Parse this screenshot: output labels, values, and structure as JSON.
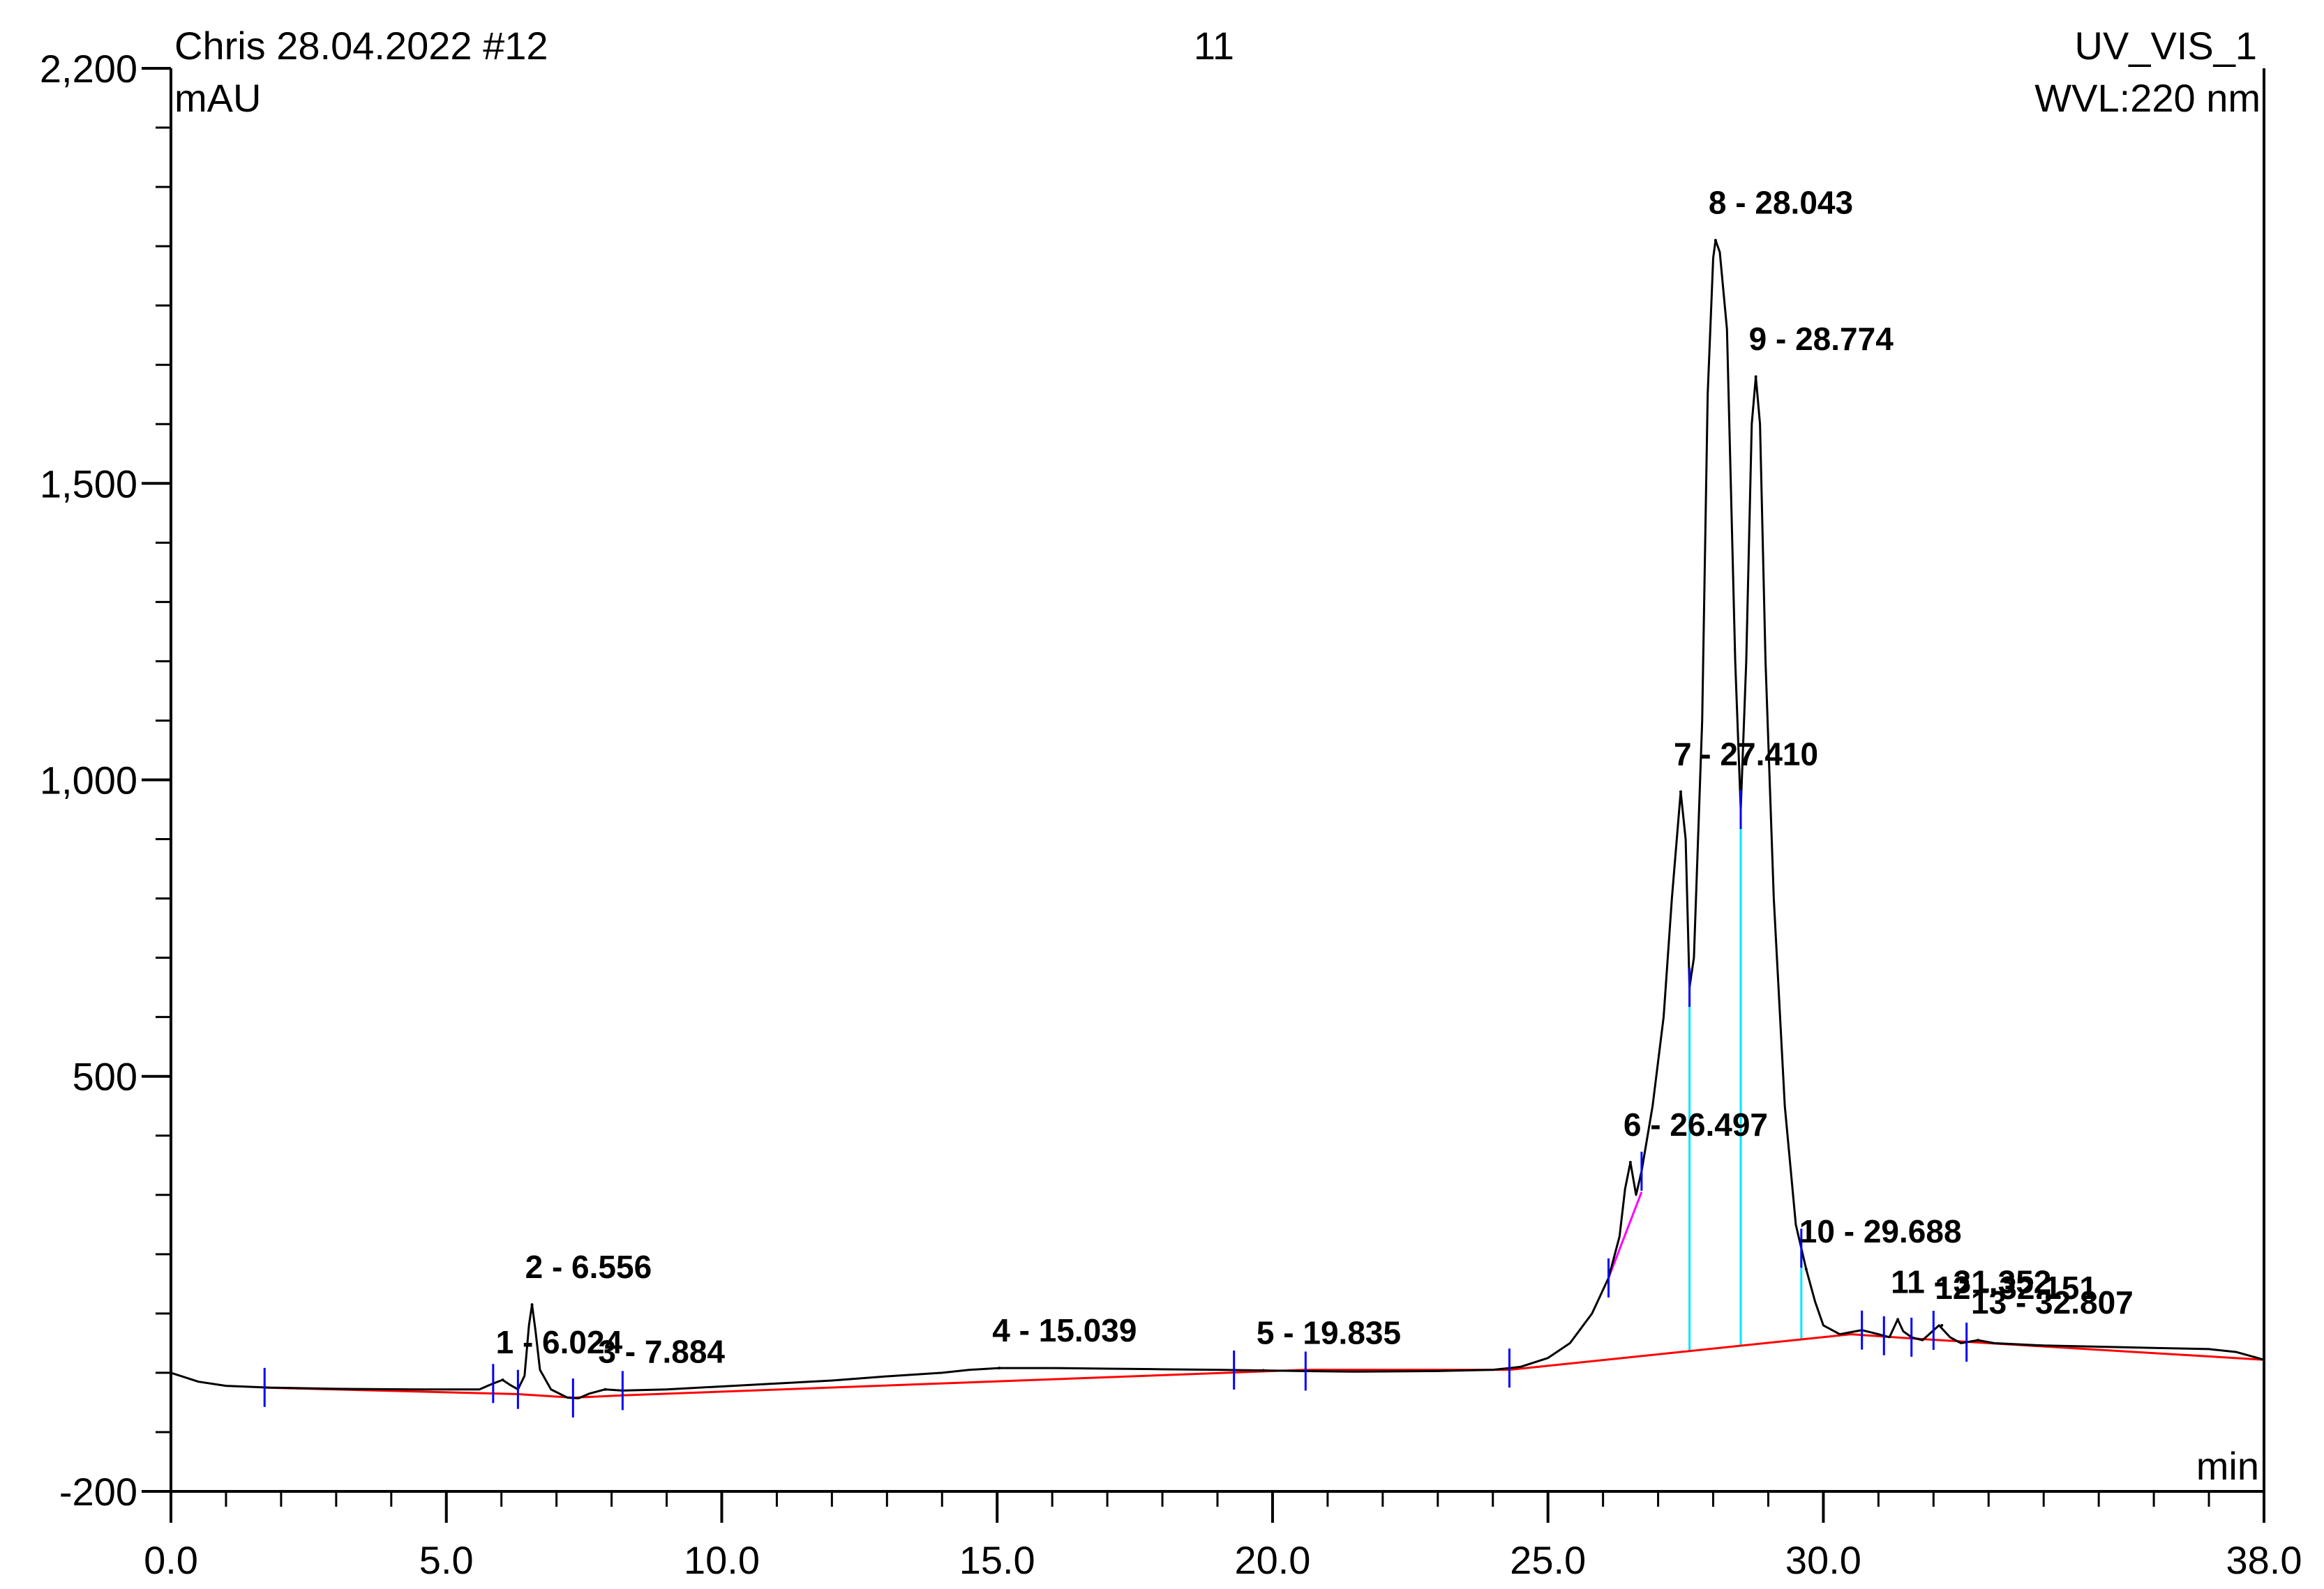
{
  "header": {
    "sample": "Chris 28.04.2022 #12",
    "injection": "11",
    "channel": "UV_VIS_1",
    "wavelength": "WVL:220 nm"
  },
  "chart_data": {
    "type": "line",
    "title": "",
    "xlabel": "min",
    "ylabel": "mAU",
    "xlim": [
      0.0,
      38.0
    ],
    "ylim": [
      -200,
      2200
    ],
    "x_ticks": [
      "0.0",
      "5.0",
      "10.0",
      "15.0",
      "20.0",
      "25.0",
      "30.0",
      "38.0"
    ],
    "x_tick_values": [
      0,
      5,
      10,
      15,
      20,
      25,
      30,
      38
    ],
    "y_ticks": [
      "-200",
      "500",
      "1,000",
      "1,500",
      "2,200"
    ],
    "y_tick_values": [
      -200,
      500,
      1000,
      1500,
      2200
    ],
    "grid": false,
    "colors": {
      "trace": "#000000",
      "baseline": "#ff0000",
      "peak_marker": "#0000ff",
      "drop_line": "#00e5ff",
      "skim_line": "#ff00ff"
    },
    "series": [
      {
        "values": [
          [
            0.0,
            0
          ],
          [
            0.5,
            -15
          ],
          [
            1.0,
            -22
          ],
          [
            1.8,
            -25
          ],
          [
            3.0,
            -27
          ],
          [
            4.5,
            -28
          ],
          [
            5.6,
            -28
          ],
          [
            5.85,
            -18
          ],
          [
            6.02,
            -12
          ],
          [
            6.15,
            -20
          ],
          [
            6.3,
            -28
          ],
          [
            6.42,
            -5
          ],
          [
            6.5,
            80
          ],
          [
            6.556,
            115
          ],
          [
            6.62,
            70
          ],
          [
            6.7,
            5
          ],
          [
            6.9,
            -28
          ],
          [
            7.2,
            -42
          ],
          [
            7.4,
            -43
          ],
          [
            7.6,
            -35
          ],
          [
            7.8,
            -30
          ],
          [
            7.884,
            -28
          ],
          [
            8.2,
            -30
          ],
          [
            9.0,
            -28
          ],
          [
            10.0,
            -23
          ],
          [
            11.0,
            -18
          ],
          [
            12.0,
            -13
          ],
          [
            13.0,
            -6
          ],
          [
            14.0,
            0
          ],
          [
            14.5,
            5
          ],
          [
            15.039,
            8
          ],
          [
            16.0,
            8
          ],
          [
            17.0,
            7
          ],
          [
            18.0,
            6
          ],
          [
            19.0,
            5
          ],
          [
            19.835,
            4
          ],
          [
            20.5,
            3
          ],
          [
            21.5,
            2
          ],
          [
            23.0,
            3
          ],
          [
            24.0,
            5
          ],
          [
            24.5,
            10
          ],
          [
            25.0,
            25
          ],
          [
            25.4,
            50
          ],
          [
            25.8,
            100
          ],
          [
            26.1,
            160
          ],
          [
            26.3,
            230
          ],
          [
            26.4,
            310
          ],
          [
            26.497,
            355
          ],
          [
            26.6,
            300
          ],
          [
            26.7,
            340
          ],
          [
            26.9,
            450
          ],
          [
            27.1,
            600
          ],
          [
            27.25,
            800
          ],
          [
            27.41,
            980
          ],
          [
            27.5,
            900
          ],
          [
            27.57,
            650
          ],
          [
            27.65,
            700
          ],
          [
            27.8,
            1100
          ],
          [
            27.9,
            1650
          ],
          [
            28.0,
            1880
          ],
          [
            28.043,
            1910
          ],
          [
            28.12,
            1890
          ],
          [
            28.25,
            1760
          ],
          [
            28.4,
            1200
          ],
          [
            28.5,
            950
          ],
          [
            28.6,
            1200
          ],
          [
            28.7,
            1600
          ],
          [
            28.774,
            1680
          ],
          [
            28.85,
            1600
          ],
          [
            28.95,
            1200
          ],
          [
            29.1,
            800
          ],
          [
            29.3,
            450
          ],
          [
            29.5,
            250
          ],
          [
            29.688,
            175
          ],
          [
            29.85,
            120
          ],
          [
            30.0,
            80
          ],
          [
            30.3,
            65
          ],
          [
            30.7,
            72
          ],
          [
            31.0,
            65
          ],
          [
            31.2,
            60
          ],
          [
            31.35,
            90
          ],
          [
            31.45,
            70
          ],
          [
            31.6,
            60
          ],
          [
            31.8,
            55
          ],
          [
            32.1,
            80
          ],
          [
            32.3,
            60
          ],
          [
            32.5,
            50
          ],
          [
            32.807,
            55
          ],
          [
            33.1,
            50
          ],
          [
            34.0,
            46
          ],
          [
            35.0,
            44
          ],
          [
            36.0,
            42
          ],
          [
            37.0,
            40
          ],
          [
            37.5,
            35
          ],
          [
            38.0,
            22
          ]
        ]
      }
    ],
    "baseline": [
      [
        1.7,
        -25
      ],
      [
        6.3,
        -36
      ],
      [
        7.3,
        -42
      ],
      [
        8.2,
        -38
      ],
      [
        20.6,
        5
      ],
      [
        24.3,
        5
      ],
      [
        30.5,
        65
      ],
      [
        31.6,
        58
      ],
      [
        33.0,
        50
      ],
      [
        38.0,
        22
      ]
    ],
    "peaks": [
      {
        "label": "1 - 6.024",
        "x": 6.024,
        "y": -12
      },
      {
        "label": "2 - 6.556",
        "x": 6.556,
        "y": 115
      },
      {
        "label": "3 - 7.884",
        "x": 7.884,
        "y": -28
      },
      {
        "label": "4 - 15.039",
        "x": 15.039,
        "y": 8
      },
      {
        "label": "5 - 19.835",
        "x": 19.835,
        "y": 4
      },
      {
        "label": "6 - 26.497",
        "x": 26.497,
        "y": 355
      },
      {
        "label": "7 - 27.410",
        "x": 27.41,
        "y": 980
      },
      {
        "label": "8 - 28.043",
        "x": 28.043,
        "y": 1910
      },
      {
        "label": "9 - 28.774",
        "x": 28.774,
        "y": 1680
      },
      {
        "label": "10 - 29.688",
        "x": 29.688,
        "y": 175
      },
      {
        "label": "11 - 31.352",
        "x": 31.352,
        "y": 90
      },
      {
        "label": "12 - 32.151",
        "x": 32.151,
        "y": 80
      },
      {
        "label": "13 - 32.807",
        "x": 32.807,
        "y": 55
      }
    ],
    "peak_markers": [
      1.7,
      5.85,
      6.3,
      7.3,
      8.2,
      19.3,
      20.6,
      24.3,
      26.1,
      26.7,
      27.57,
      28.5,
      29.6,
      30.7,
      31.1,
      31.6,
      32.0,
      32.6,
      38.0
    ],
    "drop_lines": [
      27.57,
      28.5,
      29.6
    ]
  }
}
